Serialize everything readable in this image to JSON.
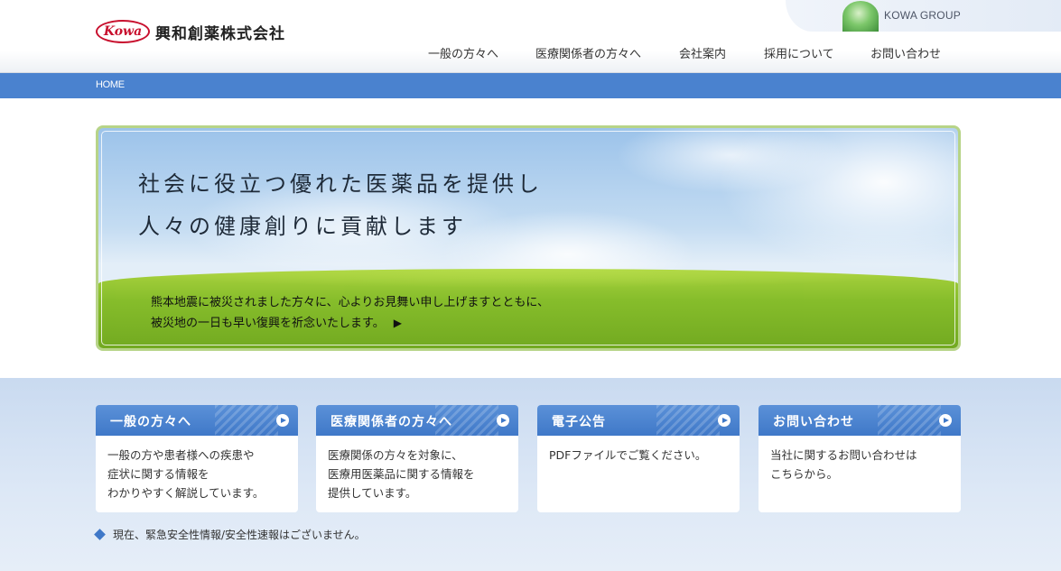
{
  "header": {
    "logo_mark": "Kowa",
    "company_name": "興和創薬株式会社",
    "group_label": "KOWA GROUP"
  },
  "nav": {
    "items": [
      {
        "label": "一般の方々へ"
      },
      {
        "label": "医療関係者の方々へ"
      },
      {
        "label": "会社案内"
      },
      {
        "label": "採用について"
      },
      {
        "label": "お問い合わせ"
      }
    ]
  },
  "breadcrumb": {
    "home": "HOME"
  },
  "hero": {
    "line1": "社会に役立つ優れた医薬品を提供し",
    "line2": "人々の健康創りに貢献します",
    "notice_line1": "熊本地震に被災されました方々に、心よりお見舞い申し上げますとともに、",
    "notice_line2": "被災地の一日も早い復興を祈念いたします。",
    "notice_arrow": "▶"
  },
  "cards": [
    {
      "title": "一般の方々へ",
      "body": [
        "一般の方や患者様への疾患や",
        "症状に関する情報を",
        "わかりやすく解説しています。"
      ]
    },
    {
      "title": "医療関係者の方々へ",
      "body": [
        "医療関係の方々を対象に、",
        "医療用医薬品に関する情報を",
        "提供しています。"
      ]
    },
    {
      "title": "電子公告",
      "body": [
        "PDFファイルでご覧ください。"
      ]
    },
    {
      "title": "お問い合わせ",
      "body": [
        "当社に関するお問い合わせは",
        "こちらから。"
      ]
    }
  ],
  "safety_notice": "現在、緊急安全性情報/安全性速報はございません。",
  "colors": {
    "accent_blue": "#4a82cf",
    "logo_red": "#c8102e",
    "hero_border": "#b7d488"
  }
}
